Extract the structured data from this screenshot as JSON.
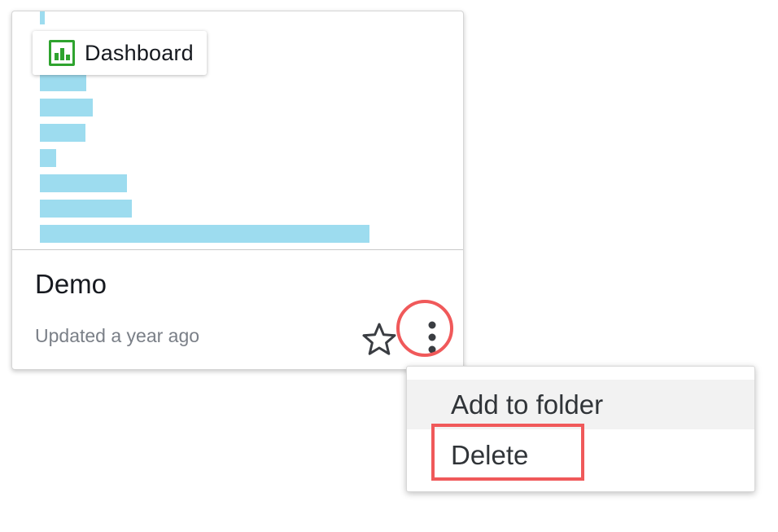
{
  "card": {
    "type_label": "Dashboard",
    "type_icon": "bar-chart-icon",
    "title": "Demo",
    "updated": "Updated a year ago",
    "favorite_icon": "star-outline-icon",
    "more_icon": "vertical-ellipsis-icon",
    "thumbnail": {
      "bar_color": "#9ddcef",
      "bar_values": [
        0.14,
        0.16,
        0.14,
        0.05,
        0.27,
        0.28,
        1.0
      ]
    }
  },
  "menu": {
    "items": [
      {
        "label": "Add to folder"
      },
      {
        "label": "Delete"
      }
    ]
  },
  "annotations": {
    "highlight_color": "#f0595a"
  }
}
